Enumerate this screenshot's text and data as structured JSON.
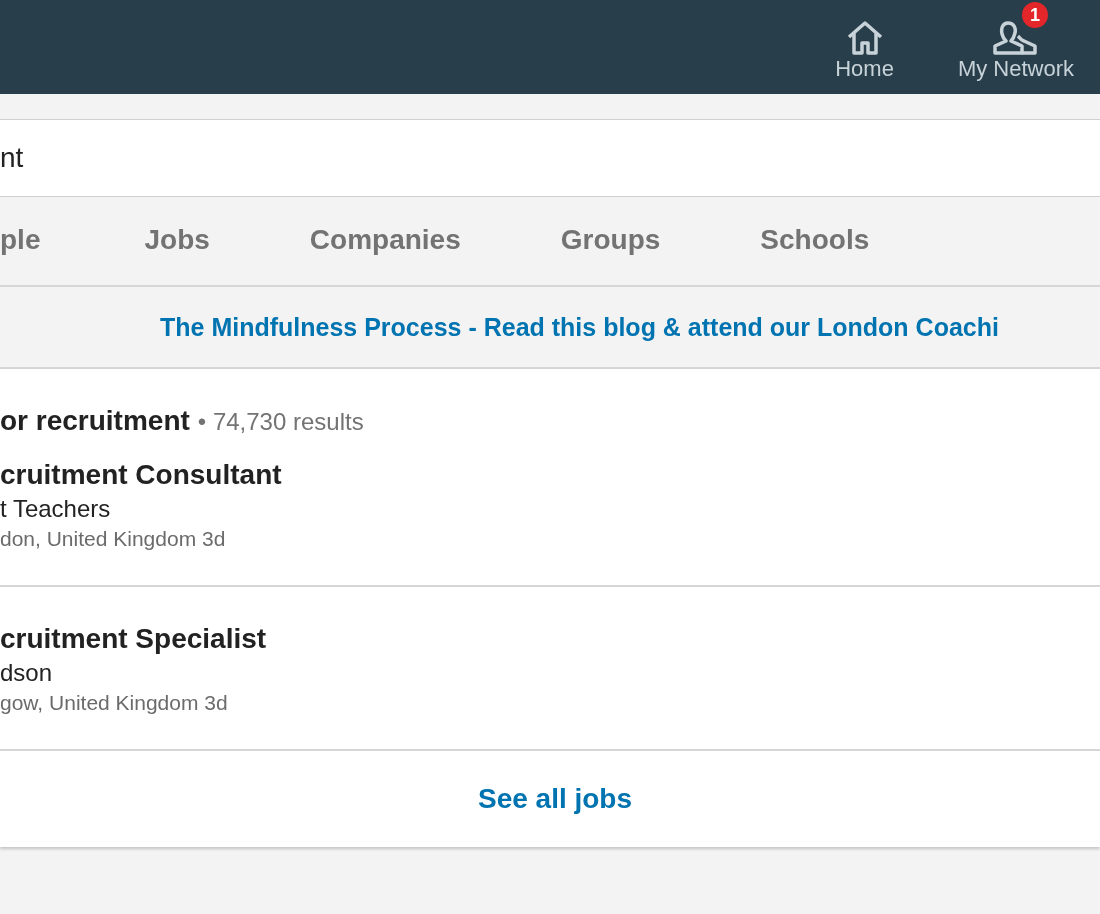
{
  "nav": [
    {
      "kind": "home",
      "label": "Home"
    },
    {
      "kind": "network",
      "label": "My Network",
      "badge": "1"
    }
  ],
  "search": {
    "value": "nt"
  },
  "tabs": [
    {
      "label": "ple",
      "selected": false
    },
    {
      "label": "Jobs",
      "selected": false
    },
    {
      "label": "Companies",
      "selected": false
    },
    {
      "label": "Groups",
      "selected": false
    },
    {
      "label": "Schools",
      "selected": false
    }
  ],
  "ad": {
    "text": "The Mindfulness Process - Read this blog & attend our London Coachi"
  },
  "results": {
    "query": "or recruitment",
    "count": "• 74,730 results",
    "jobs": [
      {
        "title": "cruitment Consultant",
        "company": "t Teachers",
        "location": "don, United Kingdom 3d"
      },
      {
        "title": "cruitment Specialist",
        "company": "dson",
        "location": "gow, United Kingdom 3d"
      }
    ],
    "see_all": "See all jobs"
  }
}
